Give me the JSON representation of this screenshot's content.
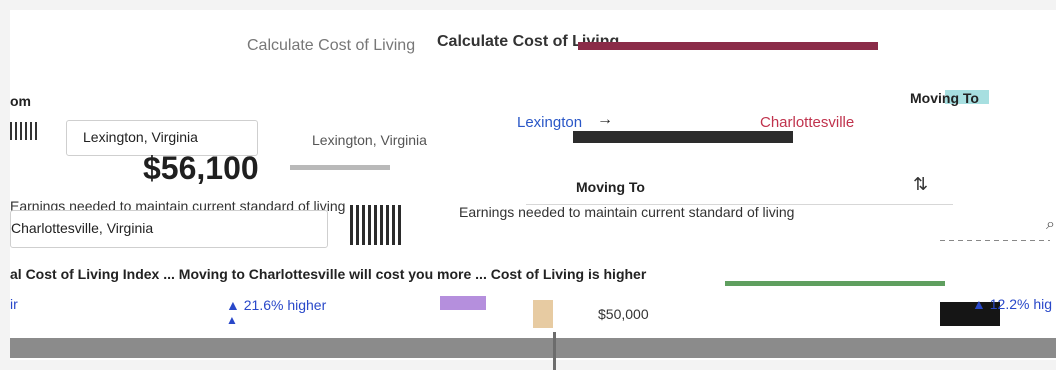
{
  "header": {
    "title_ghost": "Calculate Cost of Living",
    "title": "Calculate Cost of Living"
  },
  "moving_from": {
    "label": "om",
    "value": "Lexington, Virginia",
    "ghost_value": "Lexington, Virginia"
  },
  "moving_to_right": {
    "label": "Moving To"
  },
  "route": {
    "origin": "Lexington",
    "arrow": "→",
    "destination": "Charlottesville"
  },
  "result": {
    "salary": "$56,100",
    "earnings_note_left": "Earnings needed to maintain current standard of living",
    "earnings_note_center": "Earnings needed to maintain current standard of living"
  },
  "moving_to": {
    "label": "Moving To",
    "value": "Charlottesville, Virginia"
  },
  "stats": {
    "row_text": "al Cost of Living Index ... Moving to Charlottesville will cost you more ... Cost of Living is higher",
    "pct_left": "▲ 21.6% higher",
    "pct_left_2": "▲",
    "pct_right": "▲ 12.2% hig",
    "small_salary": "$50,000",
    "left_glyph": "ir"
  },
  "icons": {
    "swap": "swap-vertical-icon",
    "search": "search-icon"
  }
}
